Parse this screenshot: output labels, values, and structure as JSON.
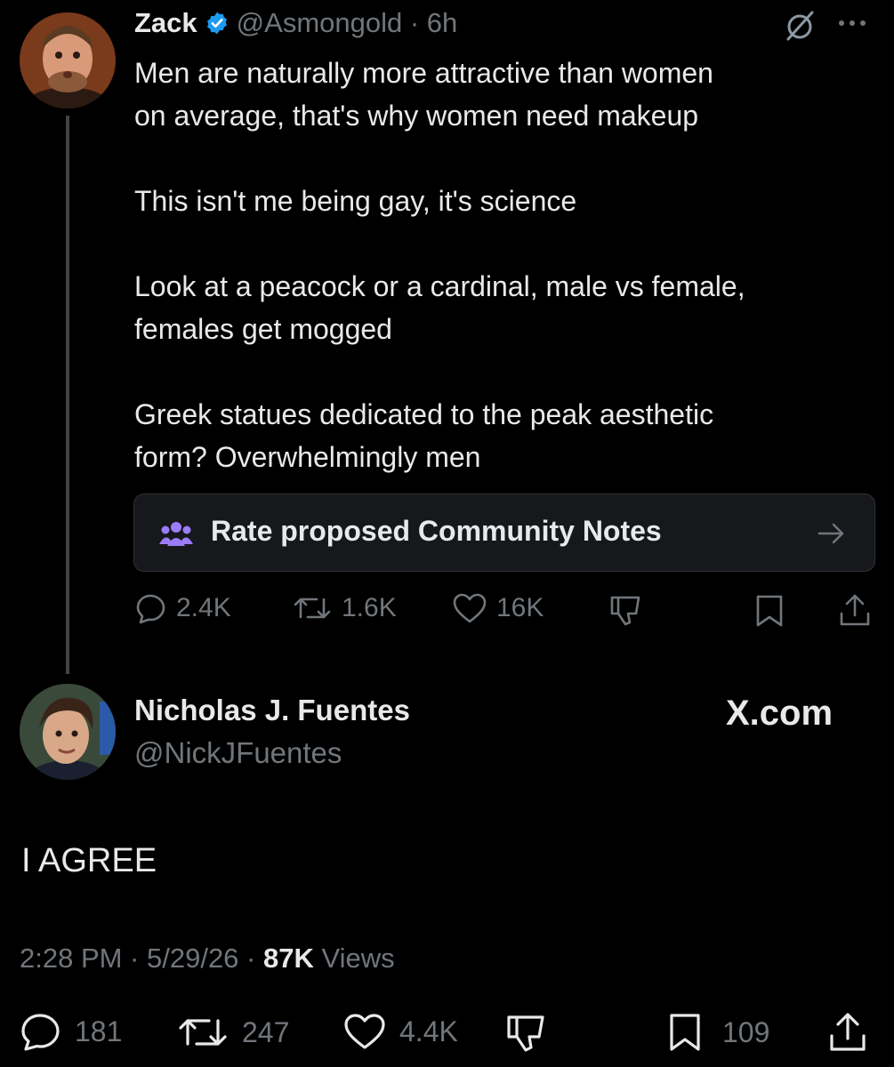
{
  "original_tweet": {
    "author_name": "Zack",
    "handle_time": "@Asmongold · 6h",
    "text": "Men are naturally more attractive than women\non average, that's why women need makeup\n\nThis isn't me being gay, it's science\n\nLook at a peacock or a cardinal, male vs female,\nfemales get mogged\n\nGreek statues dedicated to the peak aesthetic\nform? Overwhelmingly men",
    "community_notes_label": "Rate proposed Community Notes",
    "replies": "2.4K",
    "reposts": "1.6K",
    "likes": "16K",
    "icons": [
      "verified-badge-icon",
      "grok-icon",
      "more-icon",
      "community-notes-icon",
      "arrow-right-icon",
      "reply-icon",
      "repost-icon",
      "like-icon",
      "dislike-icon",
      "bookmark-icon",
      "share-icon"
    ]
  },
  "reply_tweet": {
    "author_name": "Nicholas J. Fuentes",
    "handle": "@NickJFuentes",
    "source_label": "X.com",
    "text": "I AGREE",
    "time": "2:28 PM · 5/29/26 · ",
    "views_count": "87K",
    "views_label": " Views",
    "replies": "181",
    "reposts": "247",
    "likes": "4.4K",
    "bookmarks": "109"
  },
  "colors": {
    "background": "#000000",
    "text": "#e7e9ea",
    "muted": "#71767b",
    "verified": "#1d9bf0",
    "community_notes": "#9b7cf6"
  }
}
